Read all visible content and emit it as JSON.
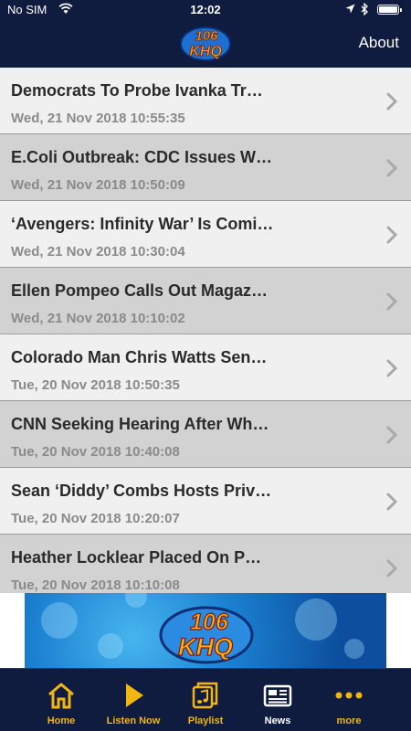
{
  "status_bar": {
    "carrier": "No SIM",
    "time": "12:02"
  },
  "header": {
    "logo_text": "106 KHQ",
    "about_label": "About"
  },
  "articles": [
    {
      "title": "Democrats To Probe Ivanka Tr…",
      "date": "Wed, 21 Nov 2018 10:55:35"
    },
    {
      "title": "E.Coli Outbreak: CDC Issues W…",
      "date": "Wed, 21 Nov 2018 10:50:09"
    },
    {
      "title": "‘Avengers: Infinity War’ Is Comi…",
      "date": "Wed, 21 Nov 2018 10:30:04"
    },
    {
      "title": "Ellen Pompeo Calls Out Magaz…",
      "date": "Wed, 21 Nov 2018 10:10:02"
    },
    {
      "title": "Colorado Man Chris Watts Sen…",
      "date": "Tue, 20 Nov 2018 10:50:35"
    },
    {
      "title": "CNN Seeking Hearing After Wh…",
      "date": "Tue, 20 Nov 2018 10:40:08"
    },
    {
      "title": "Sean ‘Diddy’ Combs Hosts Priv…",
      "date": "Tue, 20 Nov 2018 10:20:07"
    },
    {
      "title": "Heather Locklear Placed On P…",
      "date": "Tue, 20 Nov 2018 10:10:08"
    }
  ],
  "banner": {
    "logo_text": "106 KHQ"
  },
  "tabs": [
    {
      "label": "Home",
      "icon": "home-icon"
    },
    {
      "label": "Listen Now",
      "icon": "play-icon"
    },
    {
      "label": "Playlist",
      "icon": "music-note-icon"
    },
    {
      "label": "News",
      "icon": "newspaper-icon",
      "active": true
    },
    {
      "label": "more",
      "icon": "more-dots-icon"
    }
  ],
  "colors": {
    "nav_bg": "#0f1c3f",
    "accent": "#f3b50f",
    "row_light": "#f0f0f0",
    "row_dark": "#d2d2d2"
  }
}
